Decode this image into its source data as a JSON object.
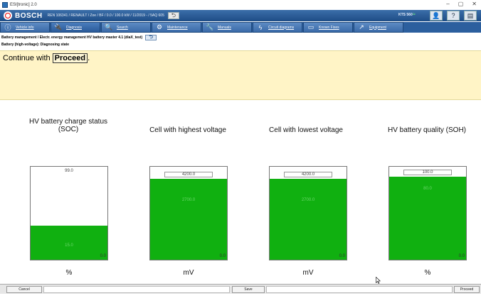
{
  "window": {
    "title": "ESI[tronic] 2.0",
    "controls": [
      "–",
      "▢",
      "✕"
    ]
  },
  "brandbar": {
    "brand": "BOSCH",
    "vehicle_info": "REN 106341 / RENAULT / Zoe / BF / 0.0 / 100.0 kW / 11/2019 - / 5AQ 605",
    "kts_label": "KTS 560",
    "icons": [
      "user-icon",
      "help-icon",
      "print-icon"
    ]
  },
  "nav": {
    "tabs": [
      {
        "label": "Vehicle info",
        "icon": "info-icon",
        "active": false
      },
      {
        "label": "Diagnosis",
        "icon": "diagnosis-icon",
        "active": true
      },
      {
        "label": "Search",
        "icon": "search-icon",
        "active": false
      },
      {
        "label": "Maintenance",
        "icon": "gears-icon",
        "active": false
      },
      {
        "label": "Manuals",
        "icon": "wrench-icon",
        "active": false
      },
      {
        "label": "Circuit diagrams",
        "icon": "lightning-icon",
        "active": false
      },
      {
        "label": "Known Fixes",
        "icon": "book-icon",
        "active": false
      },
      {
        "label": "Equipment",
        "icon": "link-icon",
        "active": false
      }
    ]
  },
  "breadcrumb": {
    "path": "Battery management / Electr. energy management HV battery master 4.1 (diaX_test)",
    "state": "Battery (high-voltage): Diagnosing state"
  },
  "message": {
    "prefix": "Continue with",
    "button_word": "Proceed",
    "suffix": "."
  },
  "gauges": [
    {
      "title_line1": "HV battery charge status",
      "title_line2": "(SOC)",
      "max_label": "99.0",
      "mid_label": "15.0",
      "min_label": "0.0",
      "unit": "%",
      "fill_fraction": 0.37,
      "boxed": false
    },
    {
      "title_line1": "Cell with highest voltage",
      "title_line2": "",
      "max_label": "4200.0",
      "mid_label": "2700.0",
      "min_label": "0.0",
      "unit": "mV",
      "fill_fraction": 0.87,
      "boxed": true
    },
    {
      "title_line1": "Cell with lowest voltage",
      "title_line2": "",
      "max_label": "4200.0",
      "mid_label": "2700.0",
      "min_label": "0.0",
      "unit": "mV",
      "fill_fraction": 0.87,
      "boxed": true
    },
    {
      "title_line1": "HV battery quality (SOH)",
      "title_line2": "",
      "max_label": "100.0",
      "mid_label": "80.0",
      "min_label": "0.0",
      "unit": "%",
      "fill_fraction": 0.89,
      "boxed": true
    }
  ],
  "bottombar": {
    "cancel": "Cancel",
    "save": "Save",
    "proceed": "Proceed"
  },
  "colors": {
    "brand_blue": "#1e4d86",
    "nav_blue": "#2c5f9e",
    "message_bg": "#fff4c6",
    "bar_green": "#10b010"
  }
}
